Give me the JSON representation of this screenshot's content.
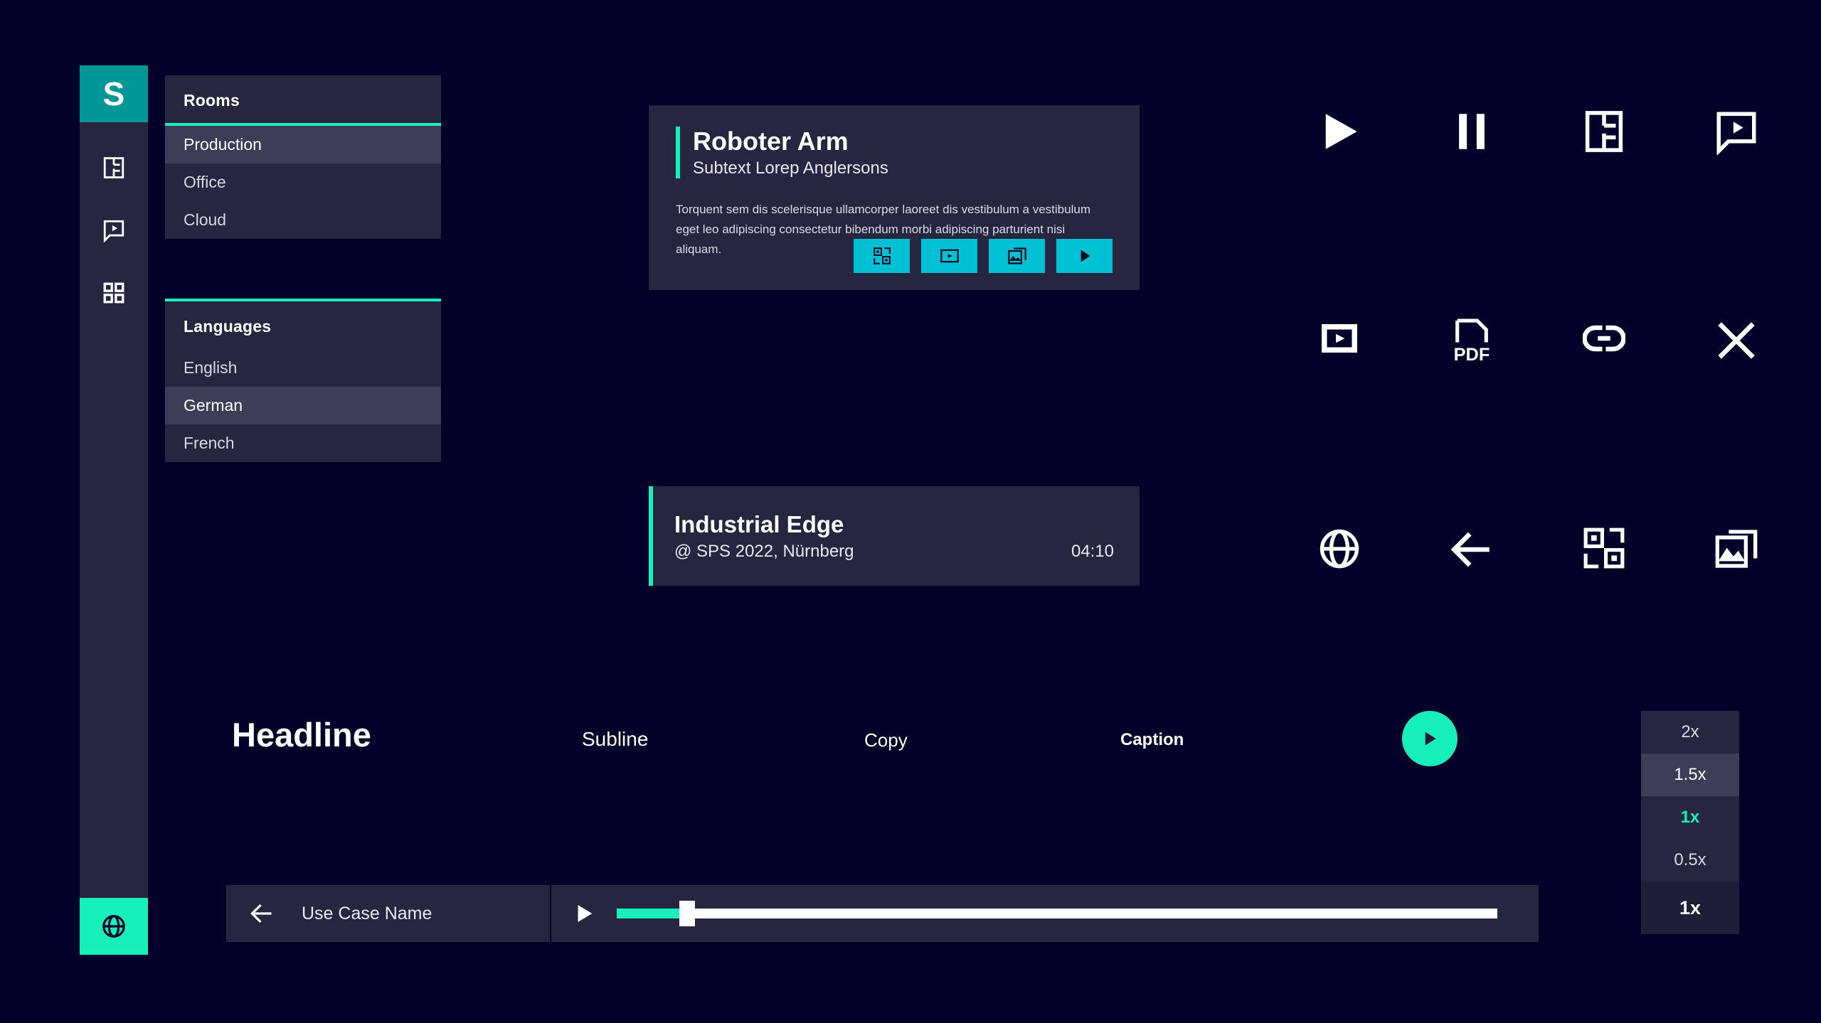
{
  "app": {
    "logo_letter": "S",
    "background_color": "#030029",
    "card_color": "#262640",
    "accent_teal": "#17f0b8",
    "accent_cyan": "#00c1d4",
    "logo_tile_color": "#009796",
    "selected_row_color": "#3d3d58"
  },
  "sidebar": {
    "items": [
      {
        "icon": "floorplan-icon",
        "label": "Floorplan"
      },
      {
        "icon": "video-bubble-icon",
        "label": "Video Chat"
      },
      {
        "icon": "grid-icon",
        "label": "Overview"
      }
    ],
    "bottom": {
      "icon": "globe-icon",
      "label": "Language"
    }
  },
  "rooms_card": {
    "title": "Rooms",
    "items": [
      {
        "label": "Production",
        "selected": true
      },
      {
        "label": "Office",
        "selected": false
      },
      {
        "label": "Cloud",
        "selected": false
      }
    ]
  },
  "languages_card": {
    "title": "Languages",
    "items": [
      {
        "label": "English",
        "selected": false
      },
      {
        "label": "German",
        "selected": true
      },
      {
        "label": "French",
        "selected": false
      }
    ]
  },
  "feature_card": {
    "title": "Roboter Arm",
    "subtitle": "Subtext Lorep Anglersons",
    "body": "Torquent sem dis scelerisque ullamcorper laoreet dis vestibulum a vestibulum eget leo adipiscing consectetur bibendum morbi adipiscing parturient nisi aliquam.",
    "actions": [
      {
        "icon": "qr-code-icon",
        "label": "QR Code"
      },
      {
        "icon": "video-icon",
        "label": "Video"
      },
      {
        "icon": "gallery-icon",
        "label": "Gallery"
      },
      {
        "icon": "play-icon",
        "label": "Play"
      }
    ]
  },
  "media_card": {
    "title": "Industrial Edge",
    "location": "@ SPS 2022, Nürnberg",
    "duration": "04:10"
  },
  "icon_gallery": {
    "icons": [
      {
        "name": "play-icon",
        "label": "Play"
      },
      {
        "name": "pause-icon",
        "label": "Pause"
      },
      {
        "name": "floorplan-icon",
        "label": "Floorplan"
      },
      {
        "name": "video-bubble-icon",
        "label": "Video Bubble"
      },
      {
        "name": "video-filled-icon",
        "label": "Video"
      },
      {
        "name": "pdf-icon",
        "label": "PDF"
      },
      {
        "name": "link-icon",
        "label": "Link"
      },
      {
        "name": "close-icon",
        "label": "Close"
      },
      {
        "name": "globe-icon",
        "label": "Globe"
      },
      {
        "name": "back-arrow-icon",
        "label": "Back"
      },
      {
        "name": "qr-code-icon",
        "label": "QR Code"
      },
      {
        "name": "gallery-icon",
        "label": "Gallery"
      }
    ],
    "pdf_label": "PDF"
  },
  "typography": {
    "headline": "Headline",
    "subline": "Subline",
    "copy": "Copy",
    "caption": "Caption"
  },
  "speed_menu": {
    "options": [
      {
        "label": "2x",
        "state": "normal"
      },
      {
        "label": "1.5x",
        "state": "hover"
      },
      {
        "label": "1x",
        "state": "active"
      },
      {
        "label": "0.5x",
        "state": "normal"
      }
    ],
    "current_button": "1x"
  },
  "player": {
    "use_case_name": "Use Case Name",
    "progress_percent": 8,
    "back_icon": "back-arrow-icon",
    "play_icon": "play-icon"
  }
}
